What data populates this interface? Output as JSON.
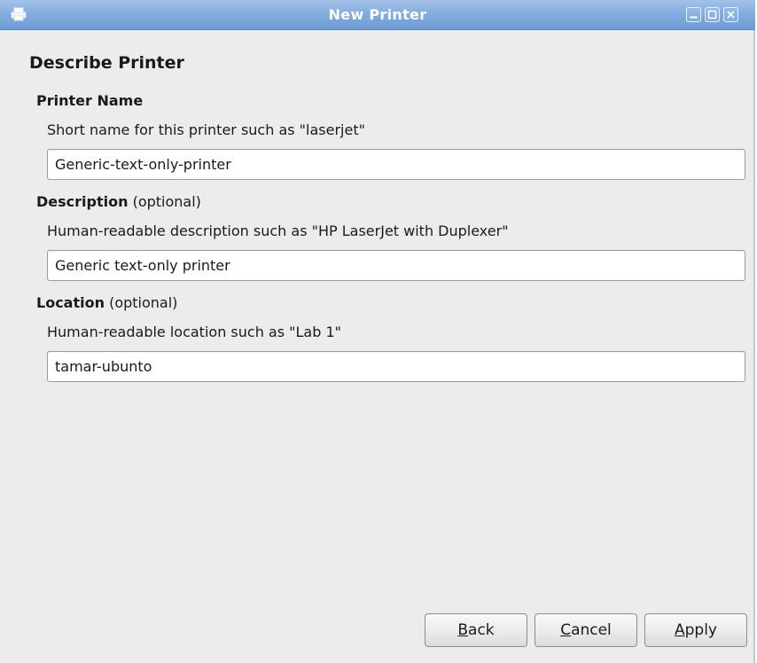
{
  "window": {
    "title": "New Printer",
    "icon": "printer-icon",
    "controls": [
      "minimize-icon",
      "maximize-icon",
      "close-icon"
    ]
  },
  "page": {
    "heading": "Describe Printer",
    "printer_name": {
      "label": "Printer Name",
      "hint": "Short name for this printer such as \"laserjet\"",
      "value": "Generic-text-only-printer"
    },
    "description": {
      "label": "Description",
      "optional": " (optional)",
      "hint": "Human-readable description such as \"HP LaserJet with Duplexer\"",
      "value": "Generic text-only printer"
    },
    "location": {
      "label": "Location",
      "optional": " (optional)",
      "hint": "Human-readable location such as \"Lab 1\"",
      "value": "tamar-ubunto"
    }
  },
  "buttons": {
    "back": {
      "mnemonic": "B",
      "rest": "ack"
    },
    "cancel": {
      "mnemonic": "C",
      "rest": "ancel"
    },
    "apply": {
      "mnemonic": "A",
      "rest": "pply"
    }
  }
}
